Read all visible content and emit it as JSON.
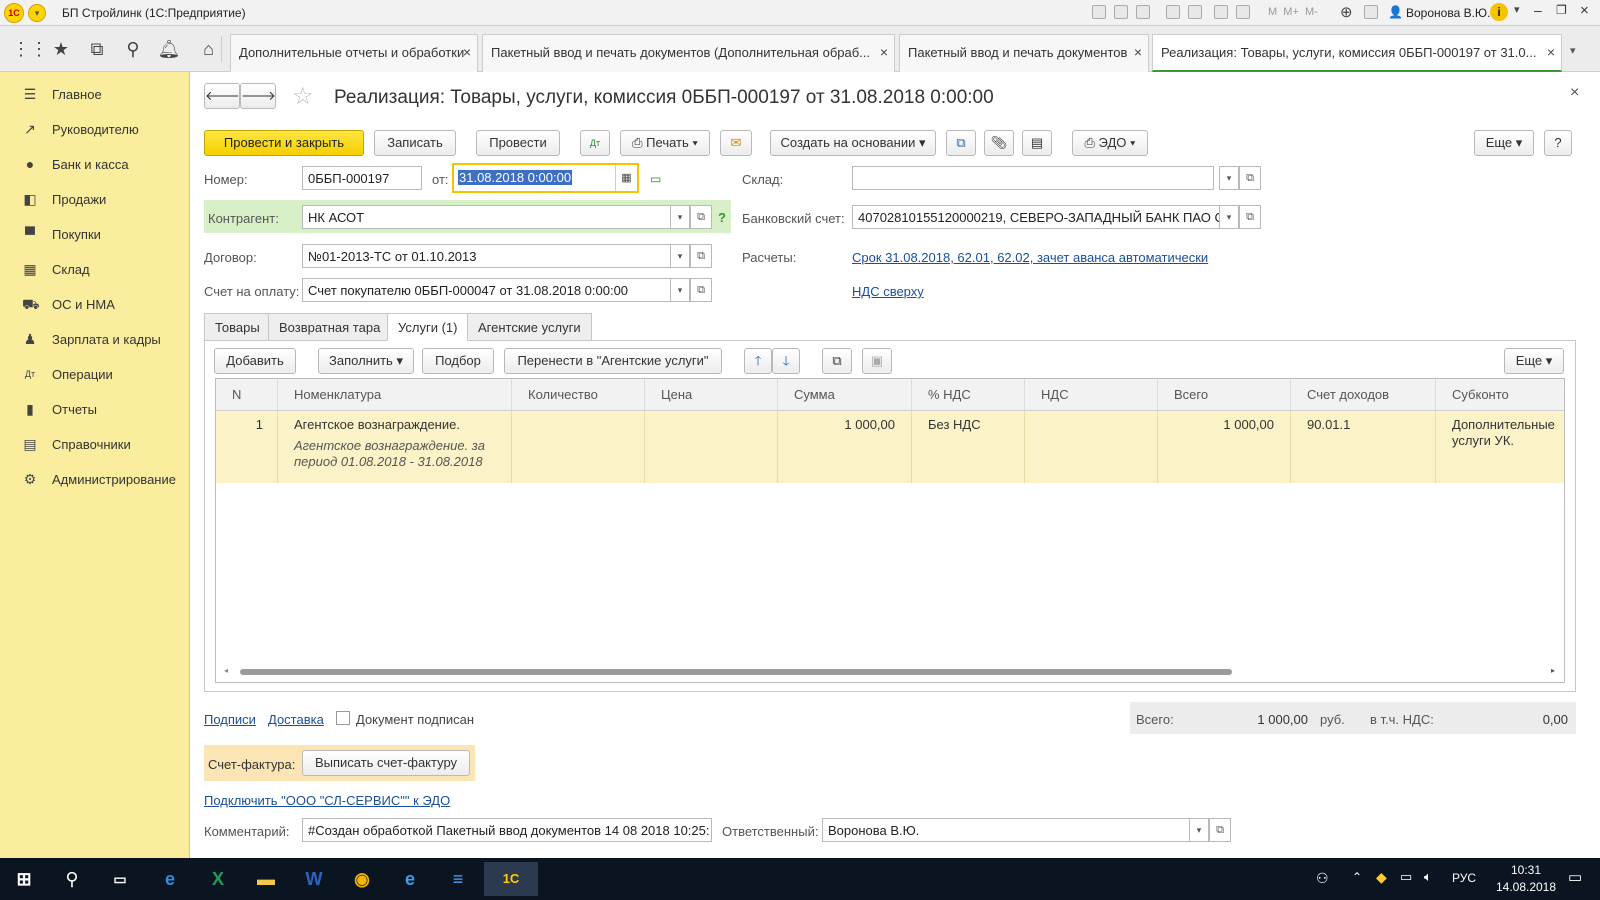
{
  "window": {
    "title": "БП Стройлинк  (1С:Предприятие)",
    "user": "Воронова В.Ю."
  },
  "tabs": [
    {
      "label": "Дополнительные отчеты и обработки"
    },
    {
      "label": "Пакетный ввод и печать документов (Дополнительная обраб..."
    },
    {
      "label": "Пакетный ввод и печать документов"
    },
    {
      "label": "Реализация: Товары, услуги, комиссия 0ББП-000197 от 31.0..."
    }
  ],
  "sidebar": {
    "items": [
      {
        "label": "Главное",
        "icon": "menu-icon"
      },
      {
        "label": "Руководителю",
        "icon": "trend-icon"
      },
      {
        "label": "Банк и касса",
        "icon": "coin-icon"
      },
      {
        "label": "Продажи",
        "icon": "cart-icon"
      },
      {
        "label": "Покупки",
        "icon": "basket-icon"
      },
      {
        "label": "Склад",
        "icon": "warehouse-icon"
      },
      {
        "label": "ОС и НМА",
        "icon": "truck-icon"
      },
      {
        "label": "Зарплата и кадры",
        "icon": "person-icon"
      },
      {
        "label": "Операции",
        "icon": "dt-kt-icon"
      },
      {
        "label": "Отчеты",
        "icon": "chart-icon"
      },
      {
        "label": "Справочники",
        "icon": "book-icon"
      },
      {
        "label": "Администрирование",
        "icon": "gear-icon"
      }
    ]
  },
  "doc": {
    "title": "Реализация: Товары, услуги, комиссия 0ББП-000197 от 31.08.2018 0:00:00",
    "toolbar": {
      "post_close": "Провести и закрыть",
      "save": "Записать",
      "post": "Провести",
      "print": "Печать",
      "create_based": "Создать на основании",
      "edo": "ЭДО",
      "more": "Еще",
      "help": "?"
    },
    "fields": {
      "number_label": "Номер:",
      "number": "0ББП-000197",
      "date_label": "от:",
      "date": "31.08.2018  0:00:00",
      "warehouse_label": "Склад:",
      "warehouse": "",
      "counterparty_label": "Контрагент:",
      "counterparty": "НК АСОТ",
      "bank_label": "Банковский счет:",
      "bank": "40702810155120000219, СЕВЕРО-ЗАПАДНЫЙ БАНК ПАО С",
      "contract_label": "Договор:",
      "contract": "№01-2013-ТС от 01.10.2013",
      "settlements_label": "Расчеты:",
      "settlements_link": "Срок 31.08.2018, 62.01, 62.02, зачет аванса автоматически",
      "invoice_label": "Счет на оплату:",
      "invoice": "Счет покупателю 0ББП-000047 от 31.08.2018 0:00:00",
      "vat_link": "НДС сверху"
    },
    "subtabs": [
      {
        "label": "Товары"
      },
      {
        "label": "Возвратная тара"
      },
      {
        "label": "Услуги (1)"
      },
      {
        "label": "Агентские услуги"
      }
    ],
    "grid_toolbar": {
      "add": "Добавить",
      "fill": "Заполнить",
      "pick": "Подбор",
      "move": "Перенести в \"Агентские услуги\"",
      "more": "Еще"
    },
    "grid": {
      "columns": [
        "N",
        "Номенклатура",
        "Количество",
        "Цена",
        "Сумма",
        "% НДС",
        "НДС",
        "Всего",
        "Счет доходов",
        "Субконто"
      ],
      "rows": [
        {
          "n": "1",
          "item": "Агентское вознаграждение.",
          "item_desc": "Агентское вознаграждение. за период 01.08.2018 - 31.08.2018",
          "qty": "",
          "price": "",
          "sum": "1 000,00",
          "vat_rate": "Без НДС",
          "vat": "",
          "total": "1 000,00",
          "account": "90.01.1",
          "subconto": "Дополнительные услуги УК."
        }
      ]
    },
    "footer": {
      "signatures": "Подписи",
      "delivery": "Доставка",
      "signed": "Документ подписан",
      "total_label": "Всего:",
      "total": "1 000,00",
      "currency": "руб.",
      "vat_incl_label": "в т.ч. НДС:",
      "vat_incl": "0,00",
      "invoice_label": "Счет-фактура:",
      "invoice_btn": "Выписать счет-фактуру",
      "edo_link": "Подключить \"ООО \"СЛ-СЕРВИС\"\" к ЭДО",
      "comment_label": "Комментарий:",
      "comment": "#Создан обработкой Пакетный ввод документов 14 08 2018  10:25:",
      "responsible_label": "Ответственный:",
      "responsible": "Воронова В.Ю."
    }
  },
  "taskbar": {
    "lang": "РУС",
    "time": "10:31",
    "date": "14.08.2018"
  }
}
